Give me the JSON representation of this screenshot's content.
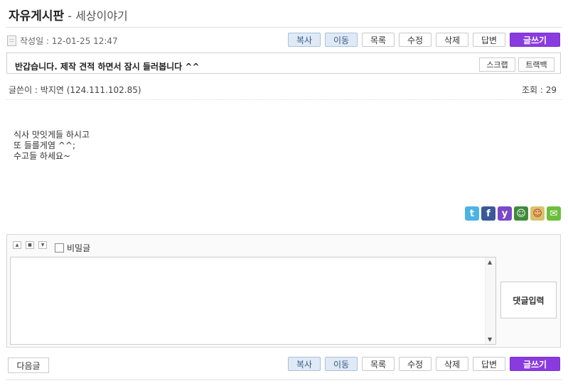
{
  "board": {
    "title": "자유게시판",
    "separator": " - ",
    "category": "세상이야기"
  },
  "post": {
    "date_label": "작성일 : 12-01-25 12:47",
    "subject": "반갑습니다. 제작 견적 하면서 잠시 들러봅니다 ^^",
    "author_label": "글쓴이 : 박지연 (124.111.102.85)",
    "views_label": "조회 : 29",
    "content_lines": [
      "식사 맛잇게들 하시고",
      "또 들를게염 ^^;",
      "수고들 하세요~"
    ]
  },
  "actions": {
    "copy": "복사",
    "move": "이동",
    "list": "목록",
    "edit": "수정",
    "delete": "삭제",
    "reply": "답변",
    "write": "글쓰기"
  },
  "tools": {
    "scrap": "스크랩",
    "trackback": "트랙백"
  },
  "comment": {
    "secret_label": "비밀글",
    "submit_label": "댓글입력"
  },
  "nav": {
    "next": "다음글"
  },
  "colors": {
    "accent": "#8a3be0",
    "blue_button": "#dfeaf6"
  },
  "sns_icons": [
    "twitter-icon",
    "facebook-icon",
    "yozm-icon",
    "me2day-icon",
    "cyworld-icon",
    "mail-icon"
  ]
}
